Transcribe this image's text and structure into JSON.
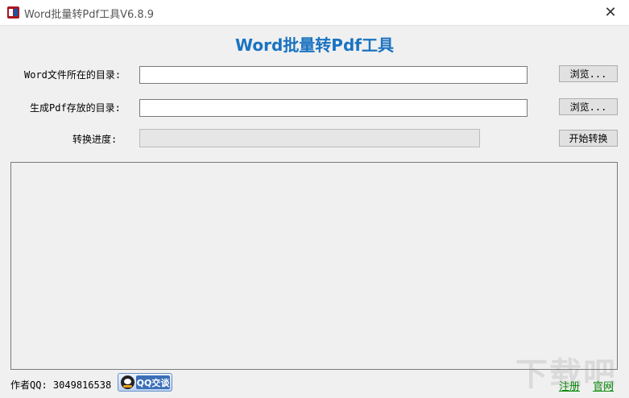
{
  "window": {
    "title": "Word批量转Pdf工具V6.8.9",
    "close_glyph": "✕"
  },
  "header": {
    "title": "Word批量转Pdf工具"
  },
  "form": {
    "source_label": "Word文件所在的目录:",
    "source_value": "",
    "source_browse": "浏览...",
    "output_label": "生成Pdf存放的目录:",
    "output_value": "",
    "output_browse": "浏览...",
    "progress_label": "转换进度:",
    "progress_value": 0,
    "start_button": "开始转换"
  },
  "log": {
    "text": ""
  },
  "footer": {
    "author_label": "作者QQ:",
    "author_qq": "3049816538",
    "qq_button_label": "QQ交谈",
    "register_link": "注册",
    "website_link": "官网"
  },
  "watermark": {
    "text": "下载吧"
  },
  "colors": {
    "title_accent": "#1a73c1",
    "link": "#0a8a0a",
    "window_bg": "#f0f0f0"
  }
}
